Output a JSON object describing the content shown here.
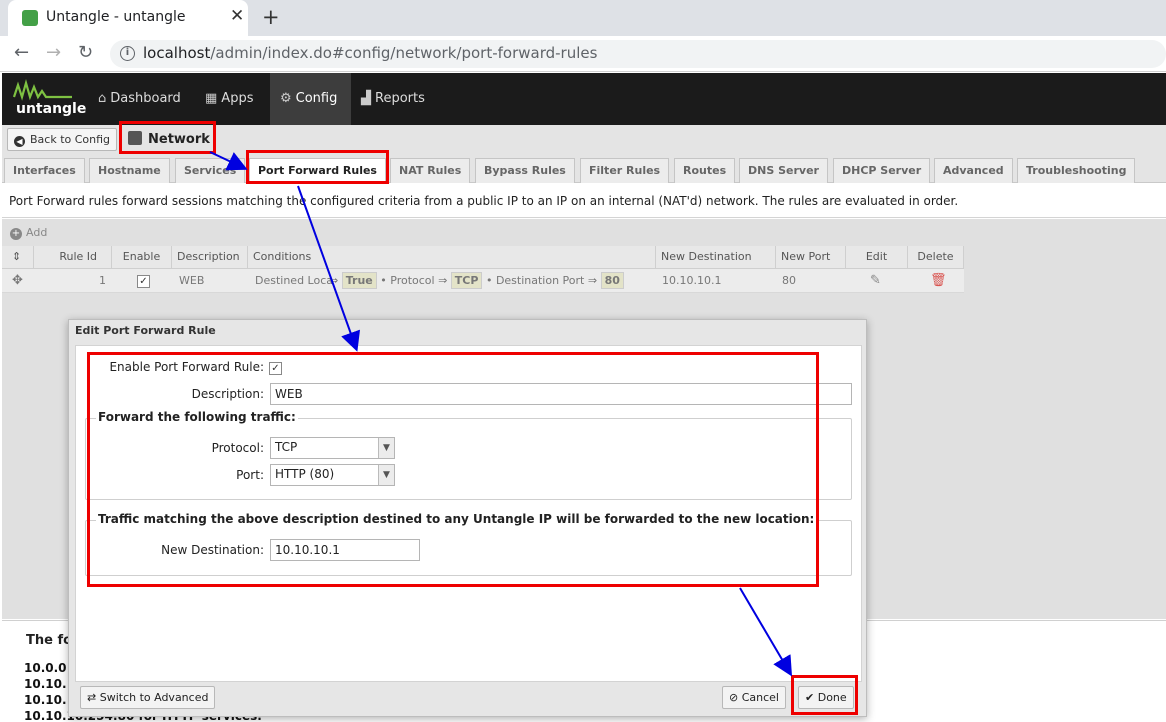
{
  "browser": {
    "tab_title": "Untangle - untangle",
    "url_host": "localhost",
    "url_path": "/admin/index.do#config/network/port-forward-rules"
  },
  "header": {
    "logo_text": "untangle",
    "nav": [
      {
        "label": "Dashboard",
        "icon": "home-icon"
      },
      {
        "label": "Apps",
        "icon": "grid-icon"
      },
      {
        "label": "Config",
        "icon": "gear-icon"
      },
      {
        "label": "Reports",
        "icon": "chart-icon"
      }
    ],
    "active_nav": "Config"
  },
  "toolbar": {
    "back_label": "Back to Config",
    "section_title": "Network"
  },
  "tabs": [
    "Interfaces",
    "Hostname",
    "Services",
    "Port Forward Rules",
    "NAT Rules",
    "Bypass Rules",
    "Filter Rules",
    "Routes",
    "DNS Server",
    "DHCP Server",
    "Advanced",
    "Troubleshooting"
  ],
  "active_tab": "Port Forward Rules",
  "description": "Port Forward rules forward sessions matching the configured criteria from a public IP to an IP on an internal (NAT'd) network. The rules are evaluated in order.",
  "grid": {
    "add_label": "Add",
    "headers": [
      "Rule Id",
      "Enable",
      "Description",
      "Conditions",
      "New Destination",
      "New Port",
      "Edit",
      "Delete"
    ],
    "row": {
      "rule_id": "1",
      "description": "WEB",
      "cond1_label": "Destined Loca",
      "cond1_value": "True",
      "cond2_label": "Protocol ⇒",
      "cond2_value": "TCP",
      "cond3_label": "Destination Port ⇒",
      "cond3_value": "80",
      "new_destination": "10.10.10.1",
      "new_port": "80"
    }
  },
  "bottom": {
    "title": "The fo",
    "lines": [
      "10.0.0",
      "10.10.",
      "10.10.",
      "10.10.10.254:80 for HTTP services."
    ]
  },
  "dialog": {
    "title": "Edit Port Forward Rule",
    "enable_label": "Enable Port Forward Rule:",
    "description_label": "Description:",
    "description_value": "WEB",
    "fieldset1_legend": "Forward the following traffic:",
    "protocol_label": "Protocol:",
    "protocol_value": "TCP",
    "port_label": "Port:",
    "port_value": "HTTP (80)",
    "fieldset2_legend": "Traffic matching the above description destined to any Untangle IP will be forwarded to the new location:",
    "new_destination_label": "New Destination:",
    "new_destination_value": "10.10.10.1",
    "switch_label": "Switch to Advanced",
    "cancel_label": "Cancel",
    "done_label": "Done"
  },
  "colors": {
    "annotation_box": "#e00000",
    "annotation_arrow": "#0000e0",
    "header_bg": "#1b1b1b"
  }
}
